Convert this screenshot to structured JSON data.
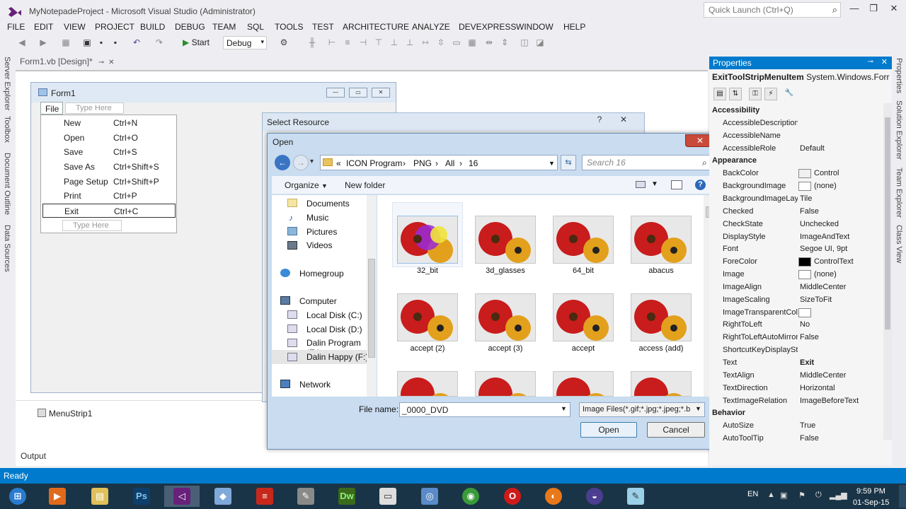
{
  "window": {
    "title": "MyNotepadeProject - Microsoft Visual Studio (Administrator)",
    "quick_launch_placeholder": "Quick Launch (Ctrl+Q)"
  },
  "menu": [
    "FILE",
    "EDIT",
    "VIEW",
    "PROJECT",
    "BUILD",
    "DEBUG",
    "TEAM",
    "SQL",
    "TOOLS",
    "TEST",
    "ARCHITECTURE",
    "ANALYZE",
    "DEVEXPRESS",
    "WINDOW",
    "HELP"
  ],
  "toolbar": {
    "start_label": "Start",
    "config_value": "Debug"
  },
  "left_tabs": [
    "Server Explorer",
    "Toolbox",
    "Document Outline",
    "Data Sources"
  ],
  "doc_tab": "Form1.vb [Design]*",
  "form1": {
    "caption": "Form1",
    "menu_file": "File",
    "type_here": "Type Here",
    "menu_items": [
      {
        "label": "New",
        "shortcut": "Ctrl+N"
      },
      {
        "label": "Open",
        "shortcut": "Ctrl+O"
      },
      {
        "label": "Save",
        "shortcut": "Ctrl+S"
      },
      {
        "label": "Save As",
        "shortcut": "Ctrl+Shift+S"
      },
      {
        "label": "Page Setup",
        "shortcut": "Ctrl+Shift+P"
      },
      {
        "label": "Print",
        "shortcut": "Ctrl+P"
      },
      {
        "label": "Exit",
        "shortcut": "Ctrl+C"
      }
    ]
  },
  "tray_component": "MenuStrip1",
  "select_resource": {
    "caption": "Select Resource",
    "help": "?",
    "close": "✕"
  },
  "open_dialog": {
    "caption": "Open",
    "close": "✕",
    "breadcrumb": [
      "«",
      "ICON Program",
      "PNG",
      "All",
      "16"
    ],
    "search_placeholder": "Search 16",
    "organize": "Organize",
    "new_folder": "New folder",
    "nav_items": [
      "Documents",
      "Music",
      "Pictures",
      "Videos",
      "Homegroup",
      "Computer",
      "Local Disk (C:)",
      "Local Disk (D:)",
      "Dalin Program (E:)",
      "Dalin Happy (F:)",
      "Network"
    ],
    "files": [
      "32_bit",
      "3d_glasses",
      "64_bit",
      "abacus",
      "accept (2)",
      "accept (3)",
      "accept",
      "access (add)"
    ],
    "file_name_label": "File name:",
    "file_name_value": "_0000_DVD",
    "file_type": "Image Files(*.gif;*.jpg;*.jpeg;*.b",
    "open_button": "Open",
    "cancel_button": "Cancel"
  },
  "properties": {
    "title": "Properties",
    "object_name": "ExitToolStripMenuItem",
    "object_type": "System.Windows.Forr",
    "rows": [
      {
        "cat": "Accessibility"
      },
      {
        "name": "AccessibleDescription",
        "value": ""
      },
      {
        "name": "AccessibleName",
        "value": ""
      },
      {
        "name": "AccessibleRole",
        "value": "Default"
      },
      {
        "cat": "Appearance"
      },
      {
        "name": "BackColor",
        "value": "Control",
        "swatch": "#f0f0f0"
      },
      {
        "name": "BackgroundImage",
        "value": "(none)",
        "swatch": "#ffffff"
      },
      {
        "name": "BackgroundImageLayout",
        "value": "Tile"
      },
      {
        "name": "Checked",
        "value": "False"
      },
      {
        "name": "CheckState",
        "value": "Unchecked"
      },
      {
        "name": "DisplayStyle",
        "value": "ImageAndText"
      },
      {
        "name": "Font",
        "value": "Segoe UI, 9pt"
      },
      {
        "name": "ForeColor",
        "value": "ControlText",
        "swatch": "#000000"
      },
      {
        "name": "Image",
        "value": "(none)",
        "swatch": "#ffffff"
      },
      {
        "name": "ImageAlign",
        "value": "MiddleCenter"
      },
      {
        "name": "ImageScaling",
        "value": "SizeToFit"
      },
      {
        "name": "ImageTransparentColor",
        "value": "",
        "swatch": "#ffffff"
      },
      {
        "name": "RightToLeft",
        "value": "No"
      },
      {
        "name": "RightToLeftAutoMirror",
        "value": "False"
      },
      {
        "name": "ShortcutKeyDisplayString",
        "value": ""
      },
      {
        "name": "Text",
        "value": "Exit",
        "bold": true
      },
      {
        "name": "TextAlign",
        "value": "MiddleCenter"
      },
      {
        "name": "TextDirection",
        "value": "Horizontal"
      },
      {
        "name": "TextImageRelation",
        "value": "ImageBeforeText"
      },
      {
        "cat": "Behavior"
      },
      {
        "name": "AutoSize",
        "value": "True"
      },
      {
        "name": "AutoToolTip",
        "value": "False"
      }
    ]
  },
  "right_tabs": [
    "Properties",
    "Solution Explorer",
    "Team Explorer",
    "Class View"
  ],
  "output_tab": "Output",
  "status": "Ready",
  "taskbar": {
    "language": "EN",
    "time": "9:59 PM",
    "date": "01-Sep-15"
  },
  "colors": {
    "accent": "#007acc",
    "taskbar": "#1a3447"
  }
}
